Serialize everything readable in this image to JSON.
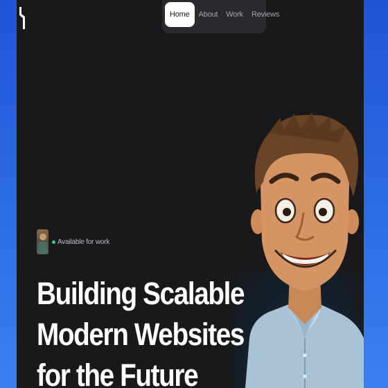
{
  "nav": {
    "items": [
      {
        "label": "Home",
        "active": true
      },
      {
        "label": "About",
        "active": false
      },
      {
        "label": "Work",
        "active": false
      },
      {
        "label": "Reviews",
        "active": false
      }
    ]
  },
  "status": {
    "text": "Available for work",
    "dot_color": "#35d17d"
  },
  "hero": {
    "headline_lines": [
      "Building Scalable",
      "Modern Websites",
      "for the Future"
    ]
  },
  "colors": {
    "page_background": "#2663e0",
    "panel_background": "#19191c",
    "nav_background": "#2a2a2e",
    "active_pill": "#ffffff"
  },
  "icons": {
    "logo": "logo-icon",
    "avatar": "avatar-thumbnail",
    "character": "cartoon-character-illustration"
  }
}
